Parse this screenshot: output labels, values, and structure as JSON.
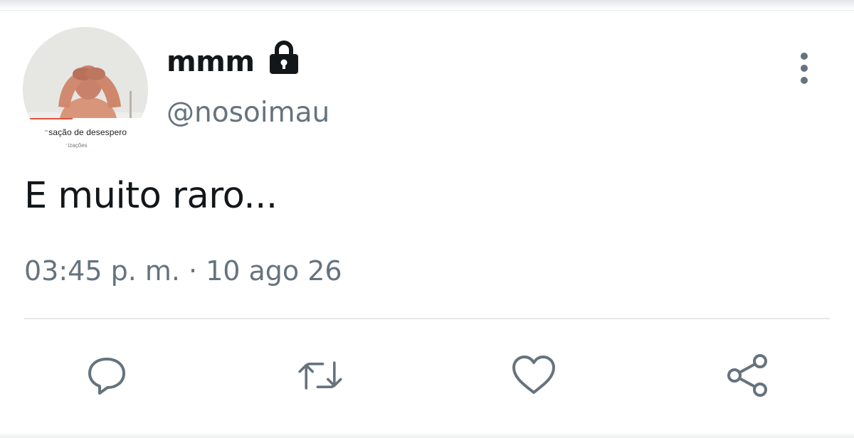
{
  "tweet": {
    "author": {
      "display_name": "mmm",
      "handle": "@nosoimau",
      "protected_icon": "lock-icon",
      "avatar_caption": "⁻sação de desespero",
      "avatar_subcaption": "⁻izações"
    },
    "more_icon": "vertical-dots-icon",
    "text": "E muito raro...",
    "time": "03:45 p. m.",
    "separator": "·",
    "date": "10 ago 26"
  },
  "actions": [
    {
      "name": "reply",
      "icon": "reply-icon"
    },
    {
      "name": "retweet",
      "icon": "retweet-icon"
    },
    {
      "name": "like",
      "icon": "heart-icon"
    },
    {
      "name": "share",
      "icon": "share-icon"
    }
  ],
  "colors": {
    "text_primary": "#14171a",
    "text_secondary": "#66737f",
    "divider": "#e6e8eb",
    "icon": "#66737f"
  }
}
